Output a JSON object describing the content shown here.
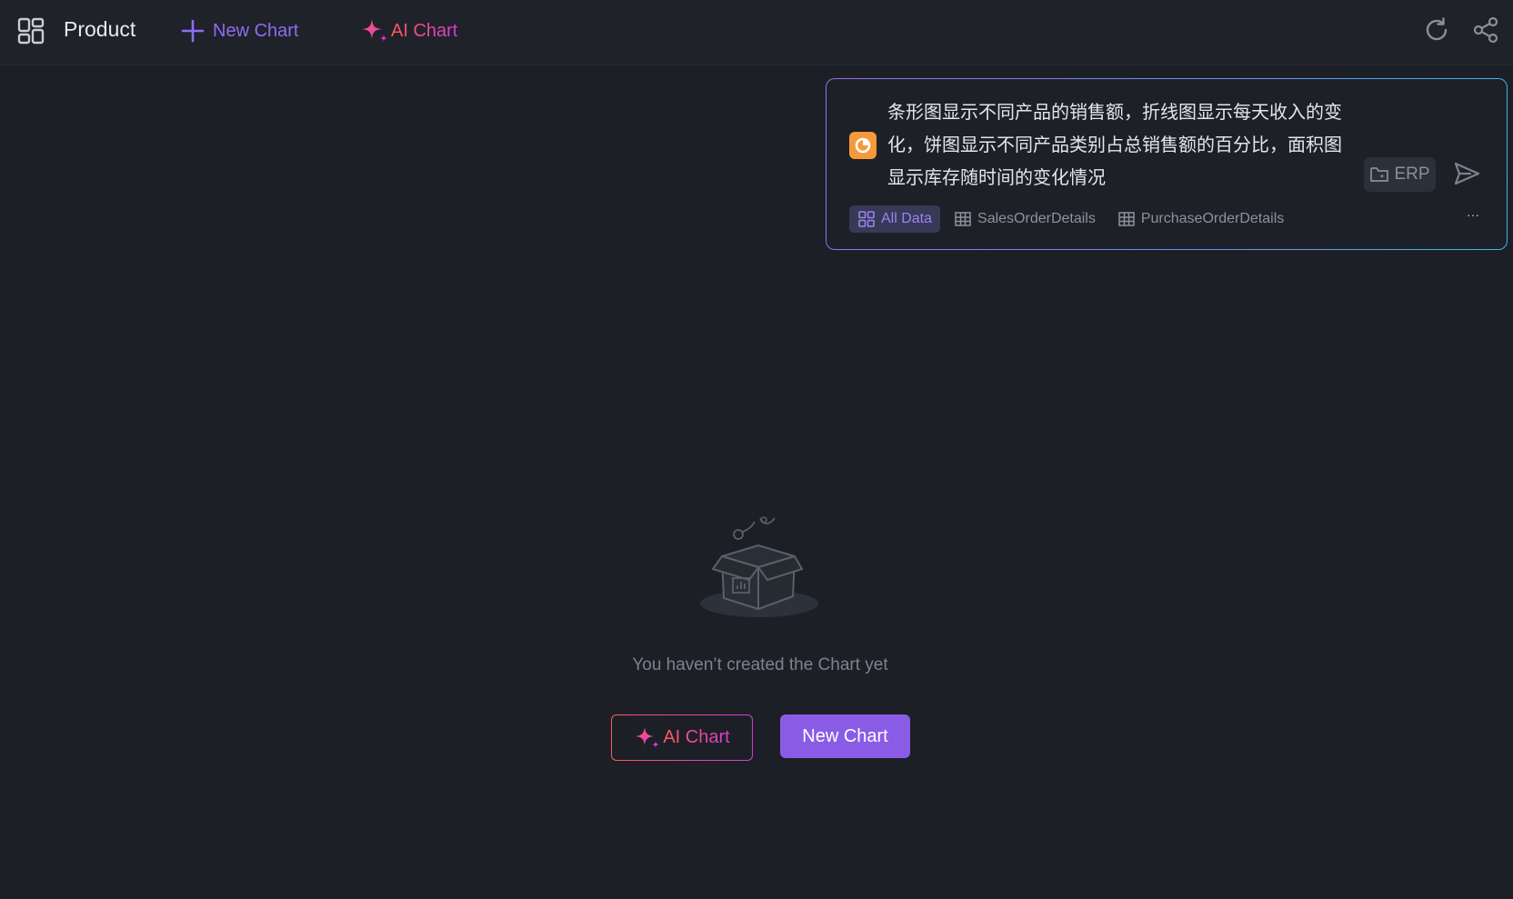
{
  "header": {
    "title": "Product",
    "new_chart_label": "New Chart",
    "ai_chart_label": "AI Chart",
    "icons": [
      "dashboard-grid-icon",
      "plus-icon",
      "sparkle-icon",
      "refresh-icon",
      "share-icon"
    ]
  },
  "prompt": {
    "text": "条形图显示不同产品的销售额，折线图显示每天收入的变化，饼图显示不同产品类别占总销售额的百分比，面积图显示库存随时间的变化情况",
    "badge_icon": "pie-chart-icon",
    "datasource_label": "ERP",
    "sources": [
      {
        "label": "All Data",
        "icon": "grid-icon",
        "active": true
      },
      {
        "label": "SalesOrderDetails",
        "icon": "table-icon",
        "active": false
      },
      {
        "label": "PurchaseOrderDetails",
        "icon": "table-icon",
        "active": false
      }
    ],
    "more_label": "···"
  },
  "empty_state": {
    "message": "You haven’t created the Chart yet",
    "ai_chart_label": "AI Chart",
    "new_chart_label": "New Chart"
  },
  "colors": {
    "background": "#1c1f26",
    "topbar": "#1f2229",
    "accent_purple": "#8a5ce6",
    "gradient_start": "#ff5a5a",
    "gradient_end": "#d63bd8",
    "badge_orange": "#f59a3a"
  }
}
